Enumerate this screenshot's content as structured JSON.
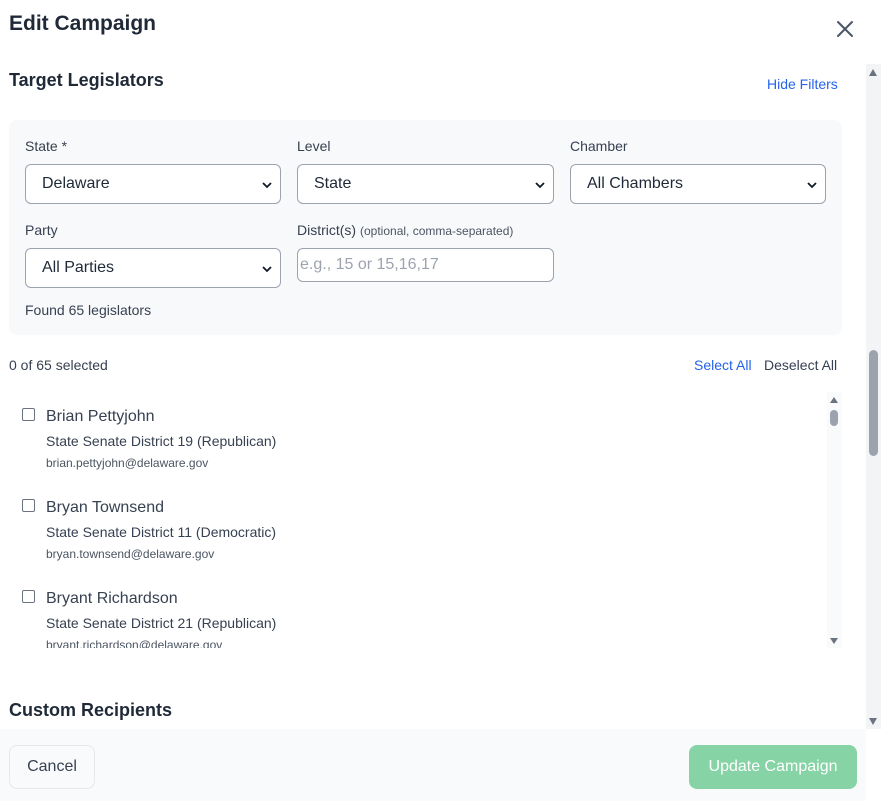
{
  "modal": {
    "title": "Edit Campaign",
    "close_icon": "close-icon"
  },
  "target": {
    "title": "Target Legislators",
    "hide_filters": "Hide Filters"
  },
  "filters": {
    "state": {
      "label": "State *",
      "value": "Delaware"
    },
    "level": {
      "label": "Level",
      "value": "State"
    },
    "chamber": {
      "label": "Chamber",
      "value": "All Chambers"
    },
    "party": {
      "label": "Party",
      "value": "All Parties"
    },
    "districts": {
      "label": "District(s)",
      "hint": "(optional, comma-separated)",
      "placeholder": "e.g., 15 or 15,16,17",
      "value": ""
    },
    "found": "Found 65 legislators"
  },
  "selection": {
    "count": "0 of 65 selected",
    "select_all": "Select All",
    "deselect_all": "Deselect All"
  },
  "legislators": [
    {
      "name": "Brian Pettyjohn",
      "role": "State Senate District 19 (Republican)",
      "email": "brian.pettyjohn@delaware.gov",
      "checked": false
    },
    {
      "name": "Bryan Townsend",
      "role": "State Senate District 11 (Democratic)",
      "email": "bryan.townsend@delaware.gov",
      "checked": false
    },
    {
      "name": "Bryant Richardson",
      "role": "State Senate District 21 (Republican)",
      "email": "bryant.richardson@delaware.gov",
      "checked": false
    }
  ],
  "custom": {
    "title": "Custom Recipients"
  },
  "footer": {
    "cancel": "Cancel",
    "update": "Update Campaign"
  },
  "colors": {
    "link": "#2563eb",
    "update_button": "#86d3a5",
    "panel_bg": "#f8f9fb"
  }
}
